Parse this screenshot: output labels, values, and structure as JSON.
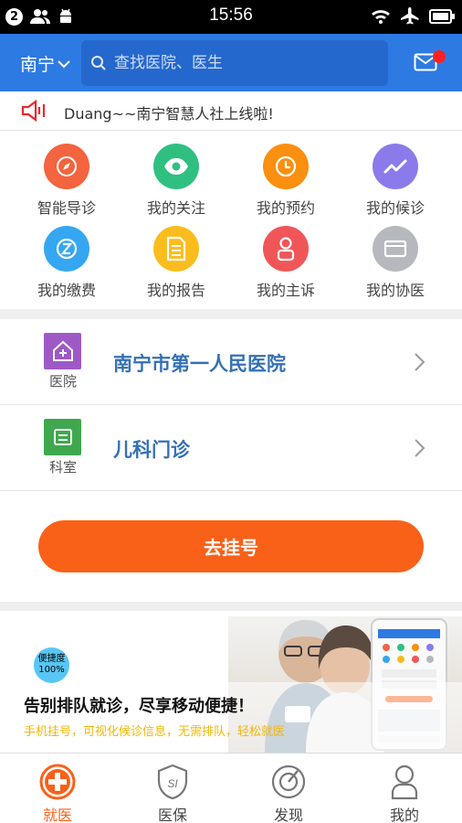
{
  "status_bar": {
    "notification_count": "2",
    "time": "15:56"
  },
  "header": {
    "city": "南宁",
    "search_placeholder": "查找医院、医生",
    "mail_icon": "mail-icon"
  },
  "notice": {
    "text": "Duang~~南宁智慧人社上线啦!"
  },
  "grid": [
    {
      "label": "智能导诊",
      "icon": "compass-icon",
      "color": "#f3643f"
    },
    {
      "label": "我的关注",
      "icon": "eye-icon",
      "color": "#2fc081"
    },
    {
      "label": "我的预约",
      "icon": "clock-icon",
      "color": "#fb8f0f"
    },
    {
      "label": "我的候诊",
      "icon": "trend-icon",
      "color": "#8b7bea"
    },
    {
      "label": "我的缴费",
      "icon": "yuan-icon",
      "color": "#35a7f2"
    },
    {
      "label": "我的报告",
      "icon": "report-icon",
      "color": "#fbbd1d"
    },
    {
      "label": "我的主诉",
      "icon": "person-icon",
      "color": "#f05658"
    },
    {
      "label": "我的协医",
      "icon": "card-icon",
      "color": "#b5b9bd"
    }
  ],
  "selection": {
    "hospital": {
      "sub": "医院",
      "title": "南宁市第一人民医院"
    },
    "department": {
      "sub": "科室",
      "title": "儿科门诊"
    }
  },
  "book_button": "去挂号",
  "banner": {
    "badge": "便捷度100%",
    "title": "告别排队就诊，尽享移动便捷！",
    "subtitle": "手机挂号，可视化候诊信息，无需排队，轻松就医"
  },
  "tabs": [
    {
      "label": "就医",
      "active": true
    },
    {
      "label": "医保",
      "active": false
    },
    {
      "label": "发现",
      "active": false
    },
    {
      "label": "我的",
      "active": false
    }
  ],
  "colors": {
    "primary": "#2d7ae3",
    "accent": "#f96119",
    "title_blue": "#3570b5"
  }
}
